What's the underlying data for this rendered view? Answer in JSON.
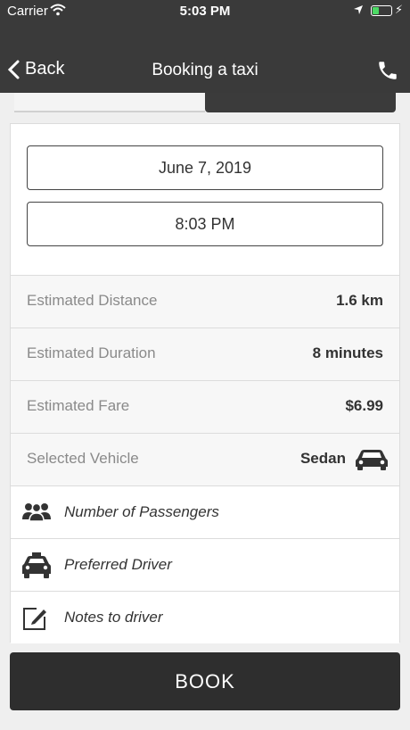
{
  "status_bar": {
    "carrier": "Carrier",
    "time": "5:03 PM"
  },
  "nav": {
    "back_label": "Back",
    "title": "Booking a taxi"
  },
  "pickers": {
    "date": "June 7, 2019",
    "time": "8:03 PM"
  },
  "info": [
    {
      "label": "Estimated Distance",
      "value": "1.6 km"
    },
    {
      "label": "Estimated Duration",
      "value": "8 minutes"
    },
    {
      "label": "Estimated Fare",
      "value": "$6.99"
    }
  ],
  "vehicle": {
    "label": "Selected Vehicle",
    "value": "Sedan"
  },
  "options": [
    {
      "label": "Number of Passengers",
      "icon": "passengers-icon"
    },
    {
      "label": "Preferred Driver",
      "icon": "taxi-icon"
    },
    {
      "label": "Notes to driver",
      "icon": "edit-note-icon"
    }
  ],
  "book_label": "BOOK",
  "colors": {
    "bar": "#3a3a3a",
    "button": "#2e2e2e",
    "battery": "#4cd964"
  }
}
